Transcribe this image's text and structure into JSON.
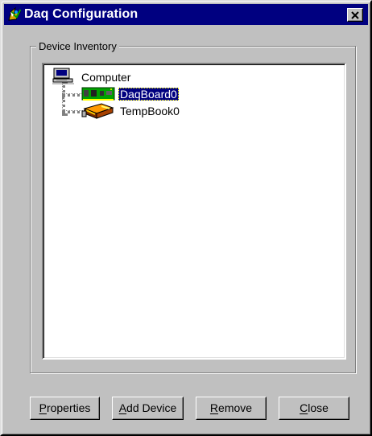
{
  "window": {
    "title": "Daq Configuration",
    "close_label": "×"
  },
  "inventory": {
    "group_title": "Device Inventory",
    "root": {
      "label": "Computer",
      "icon": "computer-icon"
    },
    "devices": [
      {
        "label": "DaqBoard0",
        "icon": "daq-board-icon",
        "selected": true
      },
      {
        "label": "TempBook0",
        "icon": "temperature-book-icon",
        "selected": false
      }
    ]
  },
  "buttons": [
    {
      "label": "Properties",
      "accelerator": "P",
      "rest": "roperties"
    },
    {
      "label": "Add Device",
      "accelerator": "A",
      "rest": "dd Device"
    },
    {
      "label": "Remove",
      "accelerator": "R",
      "rest": "emove"
    },
    {
      "label": "Close",
      "accelerator": "C",
      "rest": "lose"
    }
  ],
  "colors": {
    "title_bar": "#000080",
    "window_face": "#c0c0c0",
    "selected_item": "#000080"
  }
}
